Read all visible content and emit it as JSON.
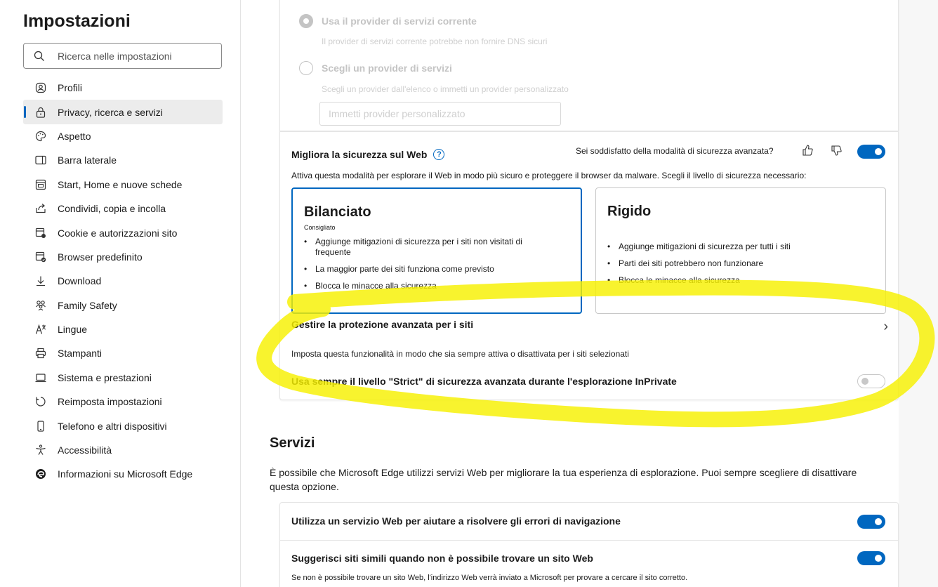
{
  "sidebar": {
    "title": "Impostazioni",
    "search_placeholder": "Ricerca nelle impostazioni",
    "items": [
      {
        "label": "Profili",
        "icon": "profile-icon"
      },
      {
        "label": "Privacy, ricerca e servizi",
        "icon": "lock-icon",
        "active": true
      },
      {
        "label": "Aspetto",
        "icon": "palette-icon"
      },
      {
        "label": "Barra laterale",
        "icon": "sidebar-icon"
      },
      {
        "label": "Start, Home e nuove schede",
        "icon": "home-tab-icon"
      },
      {
        "label": "Condividi, copia e incolla",
        "icon": "share-icon"
      },
      {
        "label": "Cookie e autorizzazioni sito",
        "icon": "cookie-icon"
      },
      {
        "label": "Browser predefinito",
        "icon": "default-browser-icon"
      },
      {
        "label": "Download",
        "icon": "download-icon"
      },
      {
        "label": "Family Safety",
        "icon": "family-icon"
      },
      {
        "label": "Lingue",
        "icon": "language-icon"
      },
      {
        "label": "Stampanti",
        "icon": "printer-icon"
      },
      {
        "label": "Sistema e prestazioni",
        "icon": "system-icon"
      },
      {
        "label": "Reimposta impostazioni",
        "icon": "reset-icon"
      },
      {
        "label": "Telefono e altri dispositivi",
        "icon": "phone-icon"
      },
      {
        "label": "Accessibilità",
        "icon": "accessibility-icon"
      },
      {
        "label": "Informazioni su Microsoft Edge",
        "icon": "edge-logo-icon"
      }
    ]
  },
  "dns": {
    "option_current_title": "Usa il provider di servizi corrente",
    "option_current_desc": "Il provider di servizi corrente potrebbe non fornire DNS sicuri",
    "option_choose_title": "Scegli un provider di servizi",
    "option_choose_desc": "Scegli un provider dall'elenco o immetti un provider personalizzato",
    "custom_placeholder": "Immetti provider personalizzato"
  },
  "security": {
    "title": "Migliora la sicurezza sul Web",
    "help": "?",
    "feedback_question": "Sei soddisfatto della modalità di sicurezza avanzata?",
    "enabled": true,
    "description": "Attiva questa modalità per esplorare il Web in modo più sicuro e proteggere il browser da malware. Scegli il livello di sicurezza necessario:",
    "levels": [
      {
        "name": "Bilanciato",
        "subtitle": "Consigliato",
        "selected": true,
        "bullets": [
          "Aggiunge mitigazioni di sicurezza per i siti non visitati di frequente",
          "La maggior parte dei siti funziona come previsto",
          "Blocca le minacce alla sicurezza"
        ]
      },
      {
        "name": "Rigido",
        "subtitle": "",
        "selected": false,
        "bullets": [
          "Aggiunge mitigazioni di sicurezza per tutti i siti",
          "Parti dei siti potrebbero non funzionare",
          "Blocca le minacce alla sicurezza"
        ]
      }
    ],
    "manage_title": "Gestire la protezione avanzata per i siti",
    "manage_chevron": "›",
    "manage_desc": "Imposta questa funzionalità in modo che sia sempre attiva o disattivata per i siti selezionati",
    "inprivate_label": "Usa sempre il livello \"Strict\" di sicurezza avanzata durante l'esplorazione InPrivate",
    "inprivate_enabled": false
  },
  "services": {
    "title": "Servizi",
    "description": "È possibile che Microsoft Edge utilizzi servizi Web per migliorare la tua esperienza di esplorazione. Puoi sempre scegliere di disattivare questa opzione.",
    "rows": [
      {
        "label": "Utilizza un servizio Web per aiutare a risolvere gli errori di navigazione",
        "desc": "",
        "enabled": true
      },
      {
        "label": "Suggerisci siti simili quando non è possibile trovare un sito Web",
        "desc": "Se non è possibile trovare un sito Web, l'indirizzo Web verrà inviato a Microsoft per provare a cercare il sito corretto.",
        "enabled": true
      }
    ]
  },
  "colors": {
    "accent": "#0067c0",
    "highlight": "#f7f000"
  }
}
